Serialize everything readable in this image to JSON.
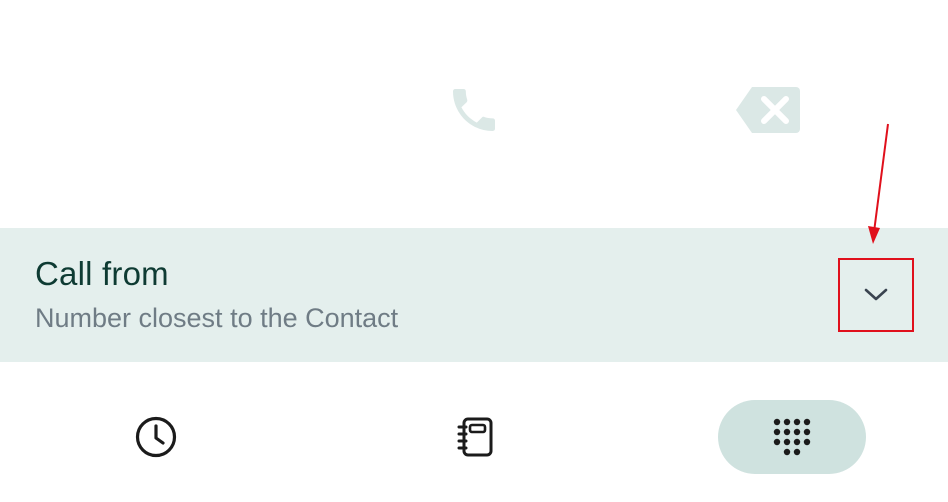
{
  "dialer": {
    "call_icon": "phone-icon",
    "backspace_icon": "backspace-icon"
  },
  "call_from": {
    "title": "Call from",
    "subtitle": "Number closest to the Contact",
    "dropdown_icon": "chevron-down-icon"
  },
  "bottom_nav": {
    "items": [
      {
        "icon": "clock-icon",
        "selected": false
      },
      {
        "icon": "contacts-book-icon",
        "selected": false
      },
      {
        "icon": "keypad-icon",
        "selected": true
      }
    ]
  },
  "colors": {
    "bar_background": "#e4efed",
    "title_text": "#0e3b33",
    "subtitle_text": "#6f7c85",
    "disabled_icon": "#dbe8e6",
    "selected_nav_pill": "#cfe2df",
    "annotation": "#e0101c"
  }
}
